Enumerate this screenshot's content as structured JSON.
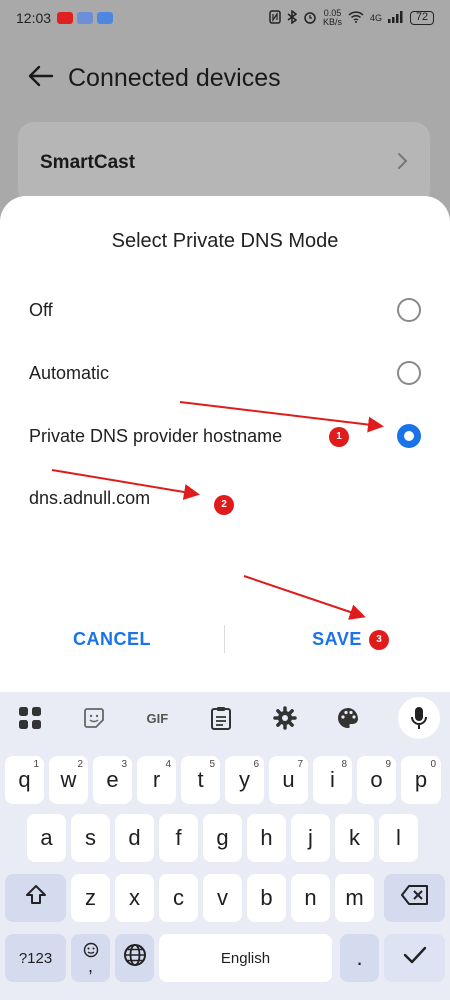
{
  "status_bar": {
    "time": "12:03",
    "net_speed_value": "0.05",
    "net_speed_unit": "KB/s",
    "network": "4G",
    "battery": "72"
  },
  "header": {
    "title": "Connected devices"
  },
  "background_list": {
    "item_label": "SmartCast"
  },
  "dialog": {
    "title": "Select Private DNS Mode",
    "options": [
      {
        "label": "Off",
        "selected": false
      },
      {
        "label": "Automatic",
        "selected": false
      },
      {
        "label": "Private DNS provider hostname",
        "selected": true
      }
    ],
    "hostname_value": "dns.adnull.com",
    "cancel_label": "CANCEL",
    "save_label": "SAVE"
  },
  "annotations": [
    {
      "number": "1"
    },
    {
      "number": "2"
    },
    {
      "number": "3"
    }
  ],
  "keyboard": {
    "toolbar": [
      "apps-grid-icon",
      "sticker-icon",
      "GIF",
      "clipboard-icon",
      "settings-gear-icon",
      "palette-icon",
      "mic-icon"
    ],
    "gif_label": "GIF",
    "row1": [
      {
        "key": "q",
        "hint": "1"
      },
      {
        "key": "w",
        "hint": "2"
      },
      {
        "key": "e",
        "hint": "3"
      },
      {
        "key": "r",
        "hint": "4"
      },
      {
        "key": "t",
        "hint": "5"
      },
      {
        "key": "y",
        "hint": "6"
      },
      {
        "key": "u",
        "hint": "7"
      },
      {
        "key": "i",
        "hint": "8"
      },
      {
        "key": "o",
        "hint": "9"
      },
      {
        "key": "p",
        "hint": "0"
      }
    ],
    "row2": [
      "a",
      "s",
      "d",
      "f",
      "g",
      "h",
      "j",
      "k",
      "l"
    ],
    "row3": [
      "z",
      "x",
      "c",
      "v",
      "b",
      "n",
      "m"
    ],
    "symbols_label": "?123",
    "comma_label": ",",
    "space_label": "English",
    "period_label": ".",
    "colors": {
      "accent": "#1a73e8",
      "annotation_red": "#e01b1b",
      "keyboard_bg": "#e9ecf5"
    }
  }
}
